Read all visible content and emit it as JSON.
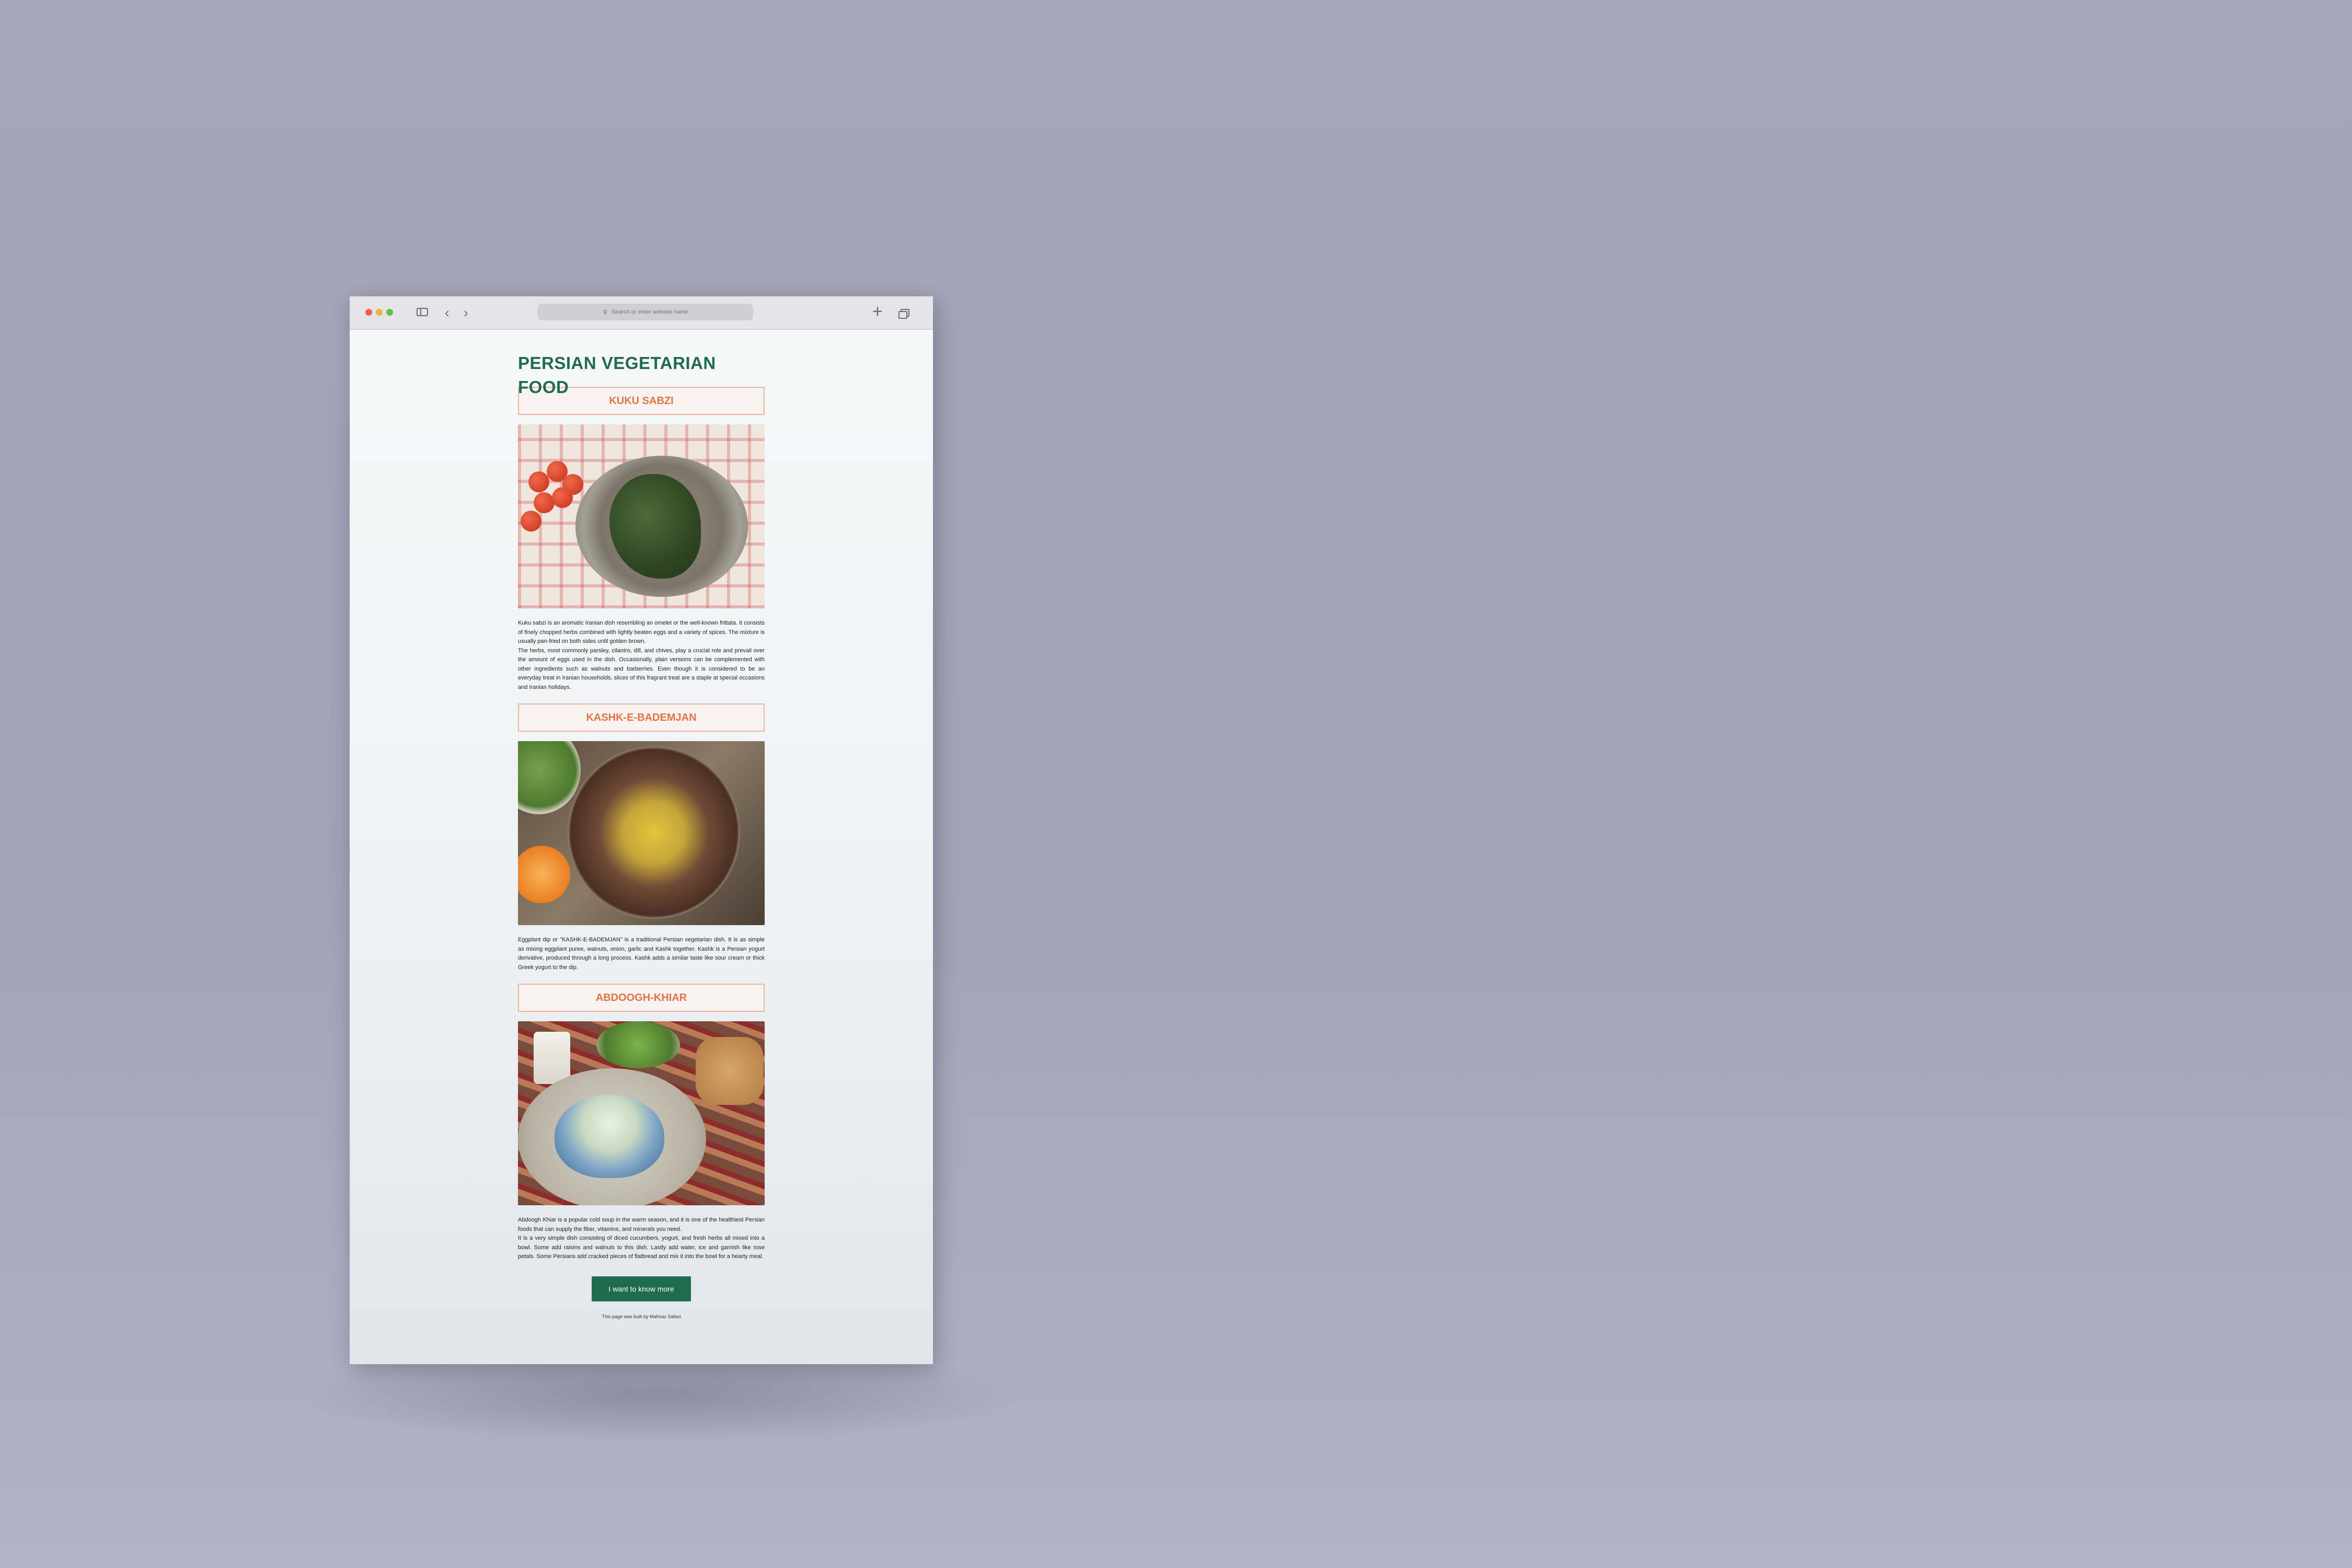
{
  "browser": {
    "address_placeholder": "Search or enter website name"
  },
  "page": {
    "title": "PERSIAN VEGETARIAN FOOD",
    "dishes": [
      {
        "heading": "KUKU SABZI",
        "image_alt": "Kuku sabzi on a metal plate with cherry tomatoes",
        "paragraphs": [
          "Kuku sabzi is an aromatic Iranian dish resembling an omelet or the well-known frittata. It consists of finely chopped herbs combined with lightly beaten eggs and a variety of spices. The mixture is usually pan-fried on both sides until golden brown.",
          "The herbs, most commonly parsley, cilantro, dill, and chives, play a crucial role and prevail over the amount of eggs used in the dish. Occasionally, plain versions can be complemented with other ingredients such as walnuts and barberries. Even though it is considered to be an everyday treat in Iranian households, slices of this fragrant treat are a staple at special occasions and Iranian holidays."
        ]
      },
      {
        "heading": "KASHK-E-BADEMJAN",
        "image_alt": "Kashk-e-bademjan in a brass pan with garnish",
        "paragraphs": [
          "Eggplant dip or \"KASHK-E-BADEMJAN\" is a traditional Persian vegetarian dish. It is as simple as mixing eggplant puree, walnuts, onion, garlic and Kashk together. Kashk is a Persian yogurt derivative, produced through a long process. Kashk adds a similar taste like sour cream or thick Greek yogurt to the dip."
        ]
      },
      {
        "heading": "ABDOOGH-KHIAR",
        "image_alt": "Abdoogh khiar cold soup served with bread and herbs",
        "paragraphs": [
          "Abdoogh Khiar is a popular cold soup in the warm season, and it is one of the healthiest Persian foods that can supply the fiber, vitamins, and minerals you need.",
          "It is a very simple dish consisting of diced cucumbers, yogurt, and fresh herbs all mixed into a bowl. Some add raisins and walnuts to this dish. Lastly add water, ice and garnish like rose petals. Some Persians add cracked pieces of flatbread and mix it into the bowl for a hearty meal."
        ]
      }
    ],
    "cta_label": "I want to know more",
    "footer": "This page was built by Mahnaz Safavi"
  },
  "icons": {
    "back": "chevron-left-icon",
    "forward": "chevron-right-icon",
    "search": "magnifier-icon",
    "new_tab": "plus-icon",
    "tabs": "tabs-overview-icon",
    "sidebar": "sidebar-icon"
  },
  "colors": {
    "title_green": "#1f6b4e",
    "heading_orange": "#e07445",
    "button_green": "#1f6b4e",
    "background": "#a7a6b9"
  }
}
